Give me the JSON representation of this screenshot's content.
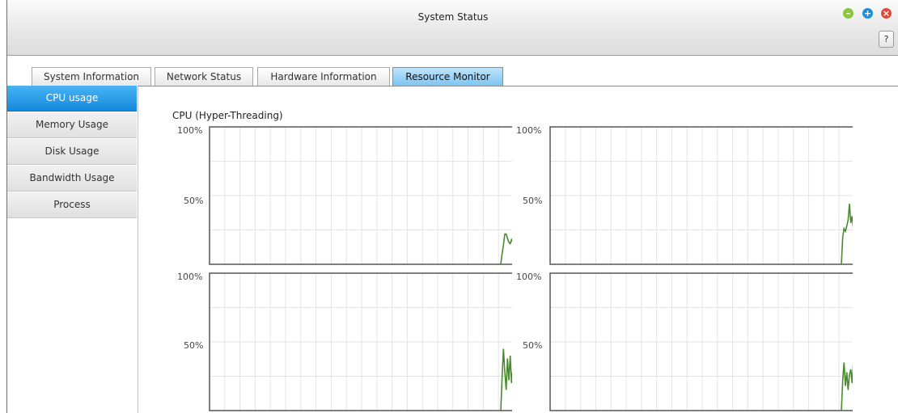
{
  "window": {
    "title": "System Status",
    "help_label": "?"
  },
  "tabs": [
    {
      "label": "System Information"
    },
    {
      "label": "Network Status"
    },
    {
      "label": "Hardware Information"
    },
    {
      "label": "Resource Monitor",
      "active": true
    }
  ],
  "sidebar": {
    "items": [
      {
        "label": "CPU usage",
        "active": true
      },
      {
        "label": "Memory Usage"
      },
      {
        "label": "Disk Usage"
      },
      {
        "label": "Bandwidth Usage"
      },
      {
        "label": "Process"
      }
    ]
  },
  "main": {
    "section_title": "CPU (Hyper-Threading)"
  },
  "colors": {
    "accent_tab": "#7cc5f2",
    "sidebar_active": "#1e8fd8",
    "line": "#4a8a2e"
  },
  "chart_data": [
    {
      "type": "line",
      "title": "",
      "yticks": [
        "100%",
        "50%"
      ],
      "ylim": [
        0,
        100
      ],
      "grid": true,
      "values": [
        0,
        8,
        14,
        22,
        22,
        19,
        16,
        15,
        18,
        16
      ]
    },
    {
      "type": "line",
      "title": "",
      "yticks": [
        "100%",
        "50%"
      ],
      "ylim": [
        0,
        100
      ],
      "grid": true,
      "values": [
        0,
        20,
        26,
        24,
        28,
        32,
        44,
        30,
        35,
        25
      ]
    },
    {
      "type": "line",
      "title": "",
      "yticks": [
        "100%",
        "50%"
      ],
      "ylim": [
        0,
        100
      ],
      "grid": true,
      "values": [
        0,
        25,
        45,
        28,
        15,
        38,
        22,
        40,
        20,
        30
      ]
    },
    {
      "type": "line",
      "title": "",
      "yticks": [
        "100%",
        "50%"
      ],
      "ylim": [
        0,
        100
      ],
      "grid": true,
      "values": [
        0,
        22,
        35,
        18,
        28,
        15,
        26,
        30,
        20,
        36
      ]
    }
  ]
}
